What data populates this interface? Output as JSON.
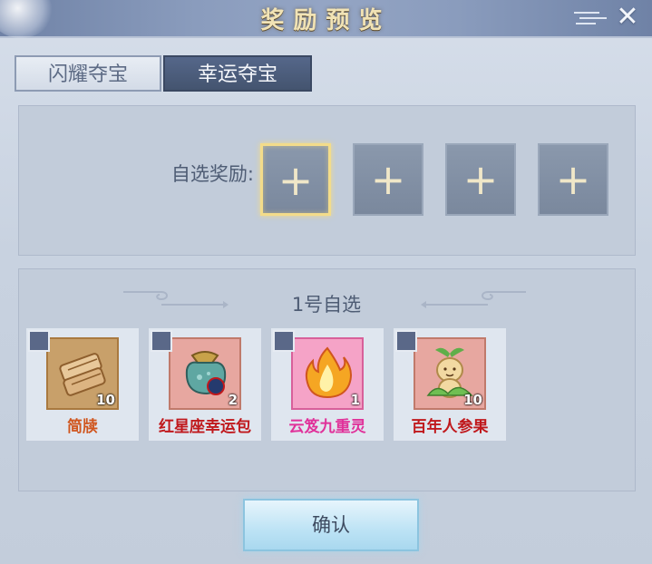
{
  "window": {
    "title": "奖励预览",
    "close_icon": "✕"
  },
  "tabs": [
    {
      "label": "闪耀夺宝",
      "active": false
    },
    {
      "label": "幸运夺宝",
      "active": true
    }
  ],
  "selection": {
    "label": "自选奖励:",
    "slot_symbol": "+",
    "slot_count": 4
  },
  "group": {
    "title": "1号自选",
    "items": [
      {
        "name": "简牍",
        "count": "10",
        "name_color": "#d0561e",
        "bg": "#c8a06a",
        "icon": "scroll-icon"
      },
      {
        "name": "红星座幸运包",
        "count": "2",
        "name_color": "#c0181c",
        "bg": "#e7a7a0",
        "icon": "lucky-bag-icon"
      },
      {
        "name": "云笈九重灵",
        "count": "1",
        "name_color": "#e0329a",
        "bg": "#f5a3c7",
        "icon": "flame-icon"
      },
      {
        "name": "百年人参果",
        "count": "10",
        "name_color": "#c0181c",
        "bg": "#e7a7a0",
        "icon": "ginseng-fruit-icon"
      }
    ]
  },
  "confirm_label": "确认"
}
